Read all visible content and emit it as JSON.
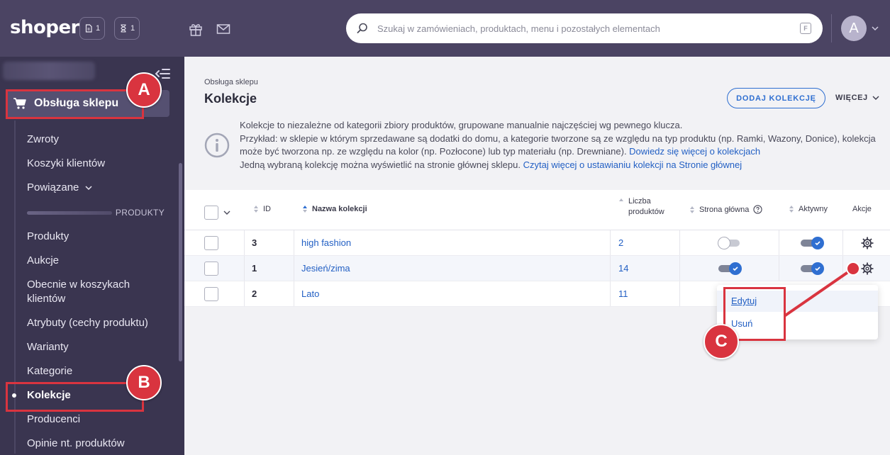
{
  "topbar": {
    "logo": "shoper",
    "orders_count": "1",
    "pending_count": "1",
    "search_placeholder": "Szukaj w zamówieniach, produktach, menu i pozostałych elementach",
    "search_shortcut": "F",
    "avatar_letter": "A"
  },
  "sidebar": {
    "active_section": "Obsługa sklepu",
    "items": [
      {
        "label": "Zwroty"
      },
      {
        "label": "Koszyki klientów"
      },
      {
        "label": "Powiązane"
      },
      {
        "label": "Produkty"
      },
      {
        "label": "Aukcje"
      },
      {
        "label": "Obecnie w koszykach klientów"
      },
      {
        "label": "Atrybuty (cechy produktu)"
      },
      {
        "label": "Warianty"
      },
      {
        "label": "Kategorie"
      },
      {
        "label": "Kolekcje"
      },
      {
        "label": "Producenci"
      },
      {
        "label": "Opinie nt. produktów"
      }
    ],
    "section_label": "PRODUKTY"
  },
  "main": {
    "breadcrumb": "Obsługa sklepu",
    "title": "Kolekcje",
    "add_button": "DODAJ KOLEKCJĘ",
    "more_button": "WIĘCEJ",
    "info": {
      "line1": "Kolekcje to niezależne od kategorii zbiory produktów, grupowane manualnie najczęściej wg pewnego klucza.",
      "line2": "Przykład: w sklepie w którym sprzedawane są dodatki do domu, a kategorie tworzone są ze względu na typ produktu (np. Ramki, Wazony, Donice), kolekcja",
      "line3": "może być tworzona np. ze względu na kolor (np. Pozłocone) lub typ materiału (np. Drewniane). ",
      "link1": "Dowiedz się więcej o kolekcjach",
      "line4": "Jedną wybraną kolekcję można wyświetlić na stronie głównej sklepu. ",
      "link2": "Czytaj więcej o ustawianiu kolekcji na Stronie głównej"
    }
  },
  "table": {
    "headers": {
      "id": "ID",
      "name": "Nazwa kolekcji",
      "count_line1": "Liczba",
      "count_line2": "produktów",
      "homepage": "Strona główna",
      "active": "Aktywny",
      "actions": "Akcje"
    },
    "rows": [
      {
        "id": "3",
        "name": "high fashion",
        "count": "2",
        "homepage": false,
        "active": true
      },
      {
        "id": "1",
        "name": "Jesień/zima",
        "count": "14",
        "homepage": true,
        "active": true
      },
      {
        "id": "2",
        "name": "Lato",
        "count": "11",
        "homepage": false,
        "active": true
      }
    ]
  },
  "dropdown": {
    "edit": "Edytuj",
    "delete": "Usuń"
  },
  "annotations": {
    "a": "A",
    "b": "B",
    "c": "C",
    "color": "#d9343f"
  }
}
